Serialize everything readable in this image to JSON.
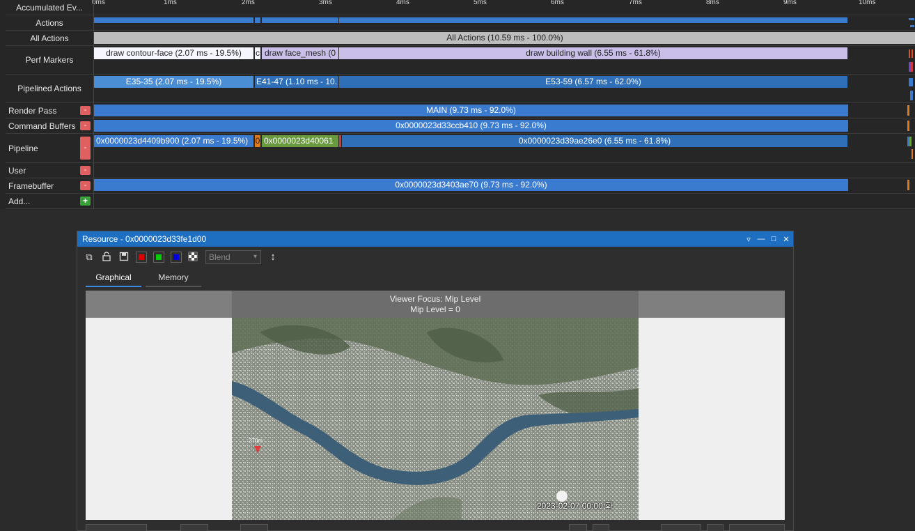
{
  "timeline": {
    "ticks": [
      "0ms",
      "1ms",
      "2ms",
      "3ms",
      "4ms",
      "5ms",
      "6ms",
      "7ms",
      "8ms",
      "9ms",
      "10ms"
    ],
    "rows": {
      "accumulated": "Accumulated Ev...",
      "actions": "Actions",
      "all_actions": "All Actions",
      "perf_markers": "Perf Markers",
      "pipelined_actions": "Pipelined Actions",
      "render_pass": "Render Pass",
      "command_buffers": "Command Buffers",
      "pipeline": "Pipeline",
      "user": "User",
      "framebuffer": "Framebuffer",
      "add": "Add..."
    },
    "minus_symbol": "-",
    "plus_symbol": "+",
    "bars": {
      "all_actions": "All Actions (10.59 ms - 100.0%)",
      "perf_draw_contour": "draw contour-face (2.07 ms - 19.5%)",
      "perf_small": "c",
      "perf_face_mesh": "draw face_mesh (0",
      "perf_building": "draw building wall (6.55 ms - 61.8%)",
      "pipe_e35": "E35-35 (2.07 ms - 19.5%)",
      "pipe_e41": "E41-47 (1.10 ms - 10.",
      "pipe_e53": "E53-59 (6.57 ms - 62.0%)",
      "render_main": "MAIN (9.73 ms - 92.0%)",
      "cmd_buffer": "0x0000023d33ccb410 (9.73 ms - 92.0%)",
      "pipeline_a": "0x0000023d4409b900 (2.07 ms - 19.5%)",
      "pipeline_b": "0",
      "pipeline_c": "0x0000023d40061",
      "pipeline_d": "0x0000023d39ae26e0 (6.55 ms - 61.8%)",
      "framebuffer": "0x0000023d3403ae70 (9.73 ms - 92.0%)"
    }
  },
  "resource_window": {
    "title": "Resource - 0x0000023d33fe1d00",
    "controls": [
      "▿",
      "—",
      "□",
      "✕"
    ],
    "toolbar": {
      "icons": [
        "copy-icon",
        "lock-icon",
        "save-icon"
      ],
      "icon_glyphs": [
        "⧉",
        "🔓",
        "💾"
      ],
      "channels": {
        "red": "#e00000",
        "green": "#00d000",
        "blue": "#0000e0"
      },
      "blend_value": "Blend",
      "flip_glyph": "↕"
    },
    "tabs": [
      "Graphical",
      "Memory"
    ],
    "viewer": {
      "focus_line1": "Viewer Focus: Mip Level",
      "focus_line2": "Mip Level = 0",
      "timestamp": "2023-02-07 00:00 화",
      "marker_label": "270m"
    }
  }
}
